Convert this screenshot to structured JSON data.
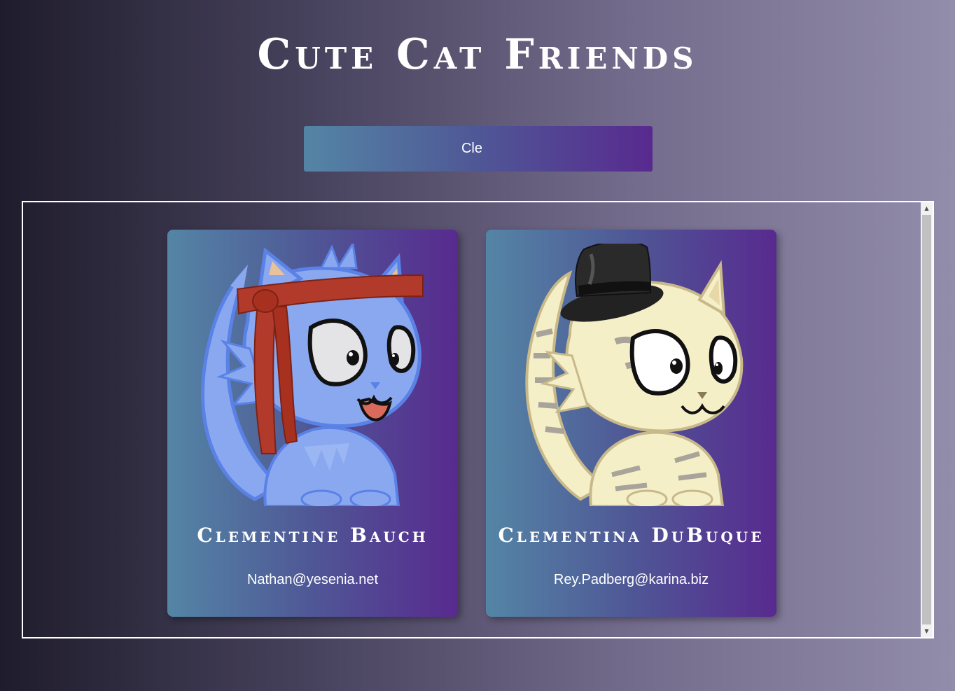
{
  "page": {
    "title": "Cute Cat Friends"
  },
  "search": {
    "value": "Cle",
    "placeholder": ""
  },
  "cards": [
    {
      "name": "Clementine Bauch",
      "email": "Nathan@yesenia.net",
      "image_icon": "blue-cat-with-red-headband-icon"
    },
    {
      "name": "Clementina DuBuque",
      "email": "Rey.Padberg@karina.biz",
      "image_icon": "cream-tabby-cat-with-top-hat-icon"
    }
  ],
  "colors": {
    "card_gradient_start": "#5485a5",
    "card_gradient_end": "#582a8f",
    "background_dark": "#1f1c2c",
    "background_light": "#928dab"
  }
}
